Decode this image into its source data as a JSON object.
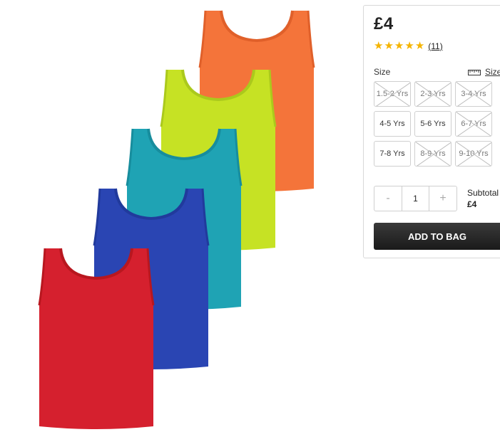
{
  "product": {
    "price": "£4",
    "rating": {
      "stars": 5,
      "review_count": "(11)"
    },
    "size_label": "Size",
    "size_guide_label": "Size",
    "sizes": [
      {
        "label": "1.5-2 Yrs",
        "available": false
      },
      {
        "label": "2-3 Yrs",
        "available": false
      },
      {
        "label": "3-4 Yrs",
        "available": false
      },
      {
        "label": "4-5 Yrs",
        "available": true
      },
      {
        "label": "5-6 Yrs",
        "available": true
      },
      {
        "label": "6-7 Yrs",
        "available": false
      },
      {
        "label": "7-8 Yrs",
        "available": true
      },
      {
        "label": "8-9 Yrs",
        "available": false
      },
      {
        "label": "9-10 Yrs",
        "available": false
      }
    ],
    "quantity": {
      "minus": "-",
      "value": "1",
      "plus": "+"
    },
    "subtotal_label": "Subtotal",
    "subtotal_value": "£4",
    "add_to_bag": "ADD TO BAG"
  },
  "image": {
    "vest_colors": [
      "#f4743a",
      "#c6e224",
      "#1fa3b4",
      "#2a45b3",
      "#d5202e"
    ]
  }
}
